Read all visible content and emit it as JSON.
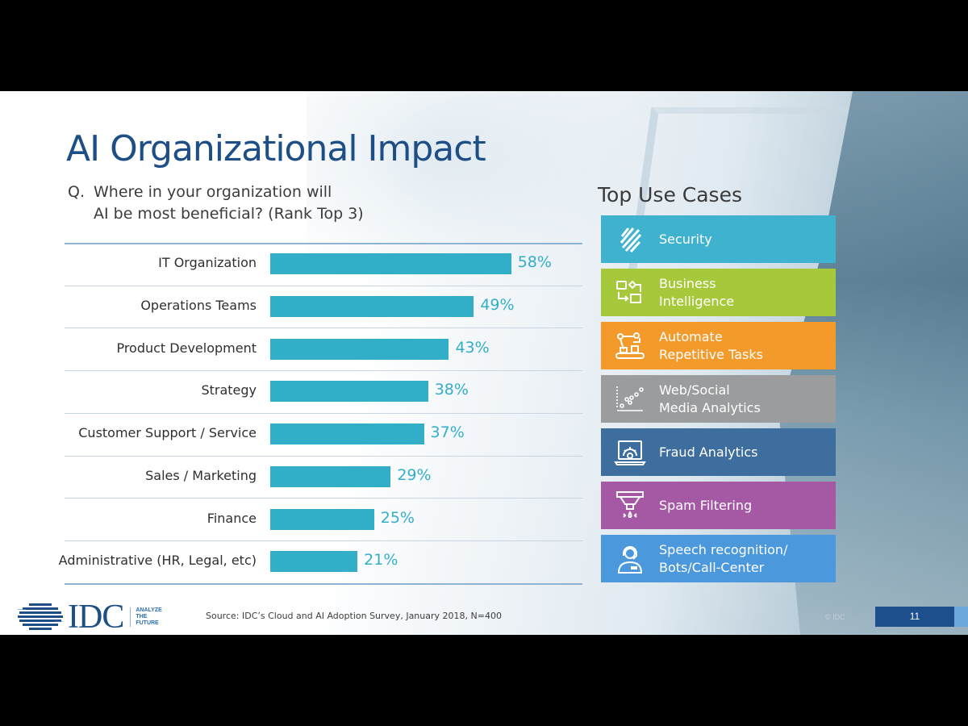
{
  "slide": {
    "title": "AI Organizational Impact",
    "question_prefix": "Q.",
    "question_line1": "Where in your organization will",
    "question_line2": "AI be most beneficial? (Rank Top 3)",
    "colors": {
      "title": "#1d4e86",
      "bar": "#33aec9",
      "page_badge": "#1c4f8b"
    }
  },
  "chart_data": {
    "type": "bar",
    "orientation": "horizontal",
    "title": "Where in your organization will AI be most beneficial? (Rank Top 3)",
    "xlabel": "",
    "ylabel": "",
    "unit": "%",
    "xlim": [
      0,
      100
    ],
    "grid": false,
    "categories": [
      "IT Organization",
      "Operations Teams",
      "Product Development",
      "Strategy",
      "Customer Support / Service",
      "Sales / Marketing",
      "Finance",
      "Administrative (HR, Legal, etc)"
    ],
    "values": [
      58,
      49,
      43,
      38,
      37,
      29,
      25,
      21
    ],
    "data_labels": [
      "58%",
      "49%",
      "43%",
      "38%",
      "37%",
      "29%",
      "25%",
      "21%"
    ]
  },
  "use_cases": {
    "title": "Top Use Cases",
    "items": [
      {
        "icon": "shield-icon",
        "line1": "Security",
        "line2": "",
        "color": "#3fb2cf"
      },
      {
        "icon": "workflow-icon",
        "line1": "Business",
        "line2": "Intelligence",
        "color": "#a5c93a"
      },
      {
        "icon": "robot-arm-icon",
        "line1": "Automate",
        "line2": "Repetitive Tasks",
        "color": "#f39a2b"
      },
      {
        "icon": "scatter-plot-icon",
        "line1": "Web/Social",
        "line2": "Media Analytics",
        "color": "#9a9c9e"
      },
      {
        "icon": "laptop-gear-icon",
        "line1": "Fraud Analytics",
        "line2": "",
        "color": "#3e6e9e"
      },
      {
        "icon": "filter-funnel-icon",
        "line1": "Spam Filtering",
        "line2": "",
        "color": "#a559a5"
      },
      {
        "icon": "headset-person-icon",
        "line1": "Speech recognition/",
        "line2": "Bots/Call-Center",
        "color": "#4b98dd"
      }
    ]
  },
  "footer": {
    "logo_text": "IDC",
    "tagline": [
      "ANALYZE",
      "THE",
      "FUTURE"
    ],
    "source": "Source: IDC’s Cloud and AI Adoption Survey, January 2018, N=400",
    "copyright": "© IDC",
    "page_number": "11"
  }
}
